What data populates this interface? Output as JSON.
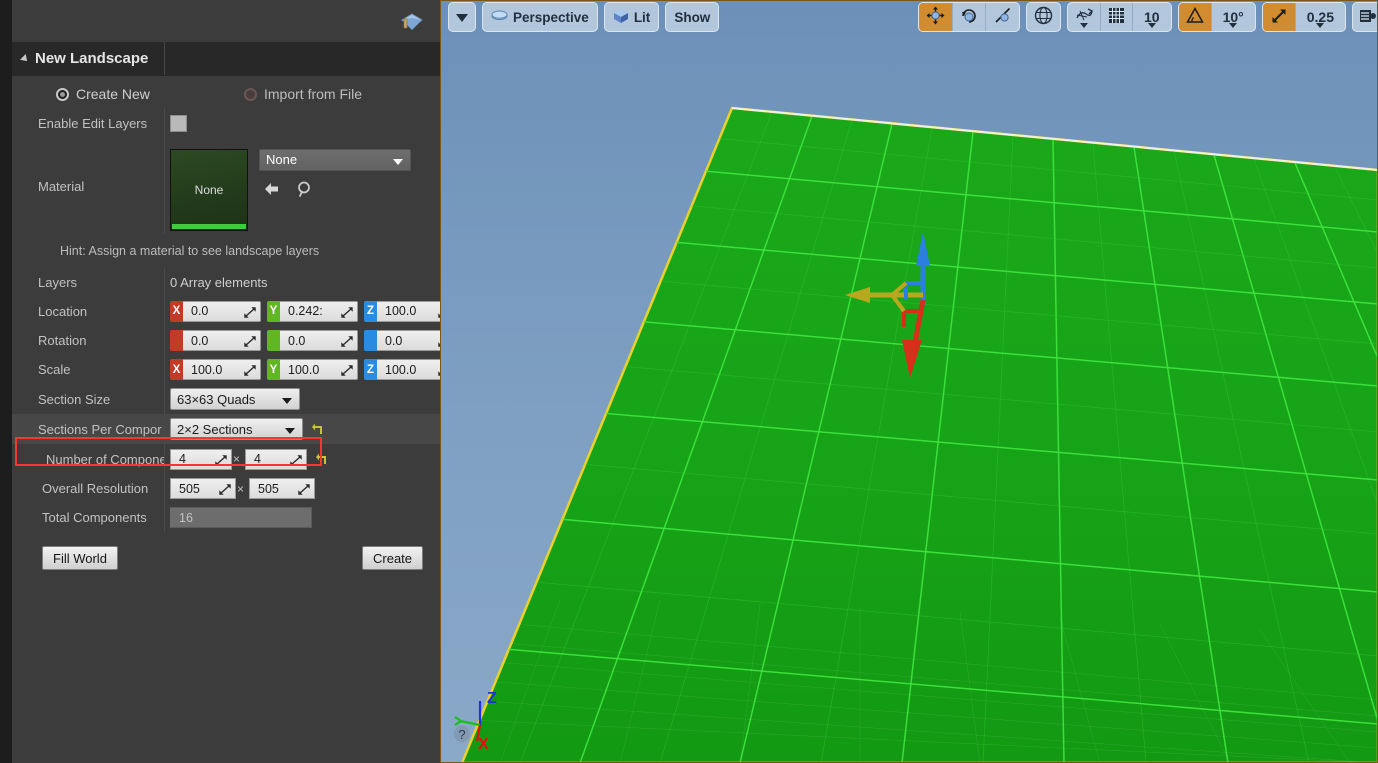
{
  "panel": {
    "mode_icon": "landscape-mode-icon",
    "section_title": "New Landscape",
    "mode_options": [
      {
        "label": "Create New",
        "selected": true
      },
      {
        "label": "Import from File",
        "selected": false
      }
    ],
    "enable_edit_layers": {
      "label": "Enable Edit Layers",
      "checked": false
    },
    "material": {
      "label": "Material",
      "thumbnail_text": "None",
      "combo_value": "None",
      "icons": [
        "back-arrow-icon",
        "browse-search-icon"
      ]
    },
    "hint": "Hint: Assign a material to see landscape layers",
    "layers": {
      "label": "Layers",
      "value": "0 Array elements"
    },
    "location": {
      "label": "Location",
      "x": "0.0",
      "y": "0.242:",
      "z": "100.0"
    },
    "rotation": {
      "label": "Rotation",
      "x": "0.0",
      "y": "0.0",
      "z": "0.0"
    },
    "scale": {
      "label": "Scale",
      "x": "100.0",
      "y": "100.0",
      "z": "100.0"
    },
    "section_size": {
      "label": "Section Size",
      "value": "63×63 Quads"
    },
    "sections_per_component": {
      "label": "Sections Per Compor",
      "value": "2×2 Sections",
      "highlighted": true
    },
    "number_of_components": {
      "label": "Number of Compone",
      "x": "4",
      "y": "4",
      "separator": "×"
    },
    "overall_resolution": {
      "label": "Overall Resolution",
      "x": "505",
      "y": "505",
      "separator": "×"
    },
    "total_components": {
      "label": "Total Components",
      "value": "16"
    },
    "buttons": {
      "fill_world": "Fill World",
      "create": "Create"
    }
  },
  "viewport": {
    "toolbar_left": [
      {
        "name": "viewport-options-menu",
        "label": "",
        "icon": "chevron-down-icon",
        "active": false
      },
      {
        "name": "camera-mode-perspective",
        "label": "Perspective",
        "icon": "camera-icon",
        "active": false
      },
      {
        "name": "view-mode-lit",
        "label": "Lit",
        "icon": "cube-icon",
        "active": false
      },
      {
        "name": "show-menu",
        "label": "Show",
        "icon": "",
        "active": false
      }
    ],
    "toolbar_right": [
      {
        "name": "transform-translate",
        "label": "",
        "icon": "move-icon",
        "active": true
      },
      {
        "name": "transform-rotate",
        "label": "",
        "icon": "rotate-icon",
        "active": false
      },
      {
        "name": "transform-scale",
        "label": "",
        "icon": "scale-icon",
        "active": false
      },
      {
        "name": "coordinate-system-world",
        "label": "",
        "icon": "globe-icon",
        "active": false
      },
      {
        "name": "surface-snapping",
        "label": "",
        "icon": "surface-snap-icon",
        "active": false
      },
      {
        "name": "grid-snap-toggle",
        "label": "",
        "icon": "grid-icon",
        "active": false
      },
      {
        "name": "grid-snap-value",
        "label": "10",
        "icon": "",
        "active": false
      },
      {
        "name": "angle-snap-toggle",
        "label": "",
        "icon": "angle-icon",
        "active": true
      },
      {
        "name": "angle-snap-value",
        "label": "10°",
        "icon": "",
        "active": false
      },
      {
        "name": "scale-snap-toggle",
        "label": "",
        "icon": "scale-snap-icon",
        "active": true
      },
      {
        "name": "scale-snap-value",
        "label": "0.25",
        "icon": "",
        "active": false
      },
      {
        "name": "camera-speed",
        "label": "",
        "icon": "camera-speed-icon",
        "active": false
      }
    ],
    "axis_gizmo": {
      "x_label": "X",
      "y_label": "Y",
      "z_label": "Z",
      "help_icon": "help-icon"
    },
    "gizmo": "translate-gizmo",
    "landscape": {
      "fill_color": "#17a317",
      "grid_color": "#3ee53e",
      "outline_color": "#e8d22a"
    },
    "sky_color": "#7fa0c2"
  }
}
